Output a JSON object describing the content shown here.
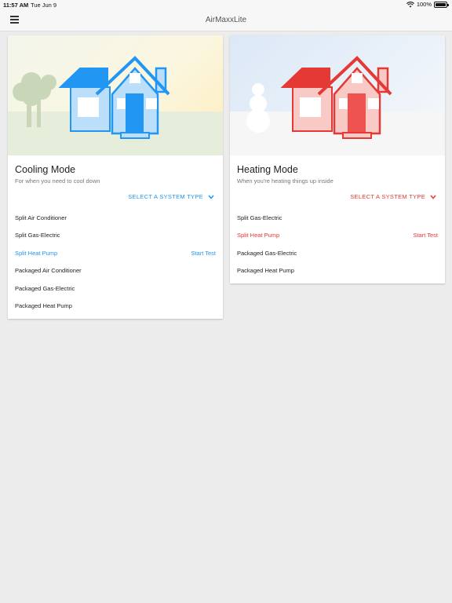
{
  "status_bar": {
    "time": "11:57 AM",
    "date": "Tue Jun 9",
    "battery": "100%"
  },
  "app_bar": {
    "title": "AirMaxxLite",
    "menu_icon": "hamburger-menu-icon"
  },
  "cooling_card": {
    "title": "Cooling Mode",
    "subtitle": "For when you need to cool down",
    "select_label": "SELECT A SYSTEM TYPE",
    "accent": "#2196f3",
    "items": [
      {
        "label": "Split Air Conditioner"
      },
      {
        "label": "Split Gas-Electric"
      },
      {
        "label": "Split Heat Pump",
        "action": "Start Test"
      },
      {
        "label": "Packaged Air Conditioner"
      },
      {
        "label": "Packaged Gas-Electric"
      },
      {
        "label": "Packaged Heat Pump"
      }
    ]
  },
  "heating_card": {
    "title": "Heating Mode",
    "subtitle": "When you're heating things up inside",
    "select_label": "SELECT A SYSTEM TYPE",
    "accent": "#e53935",
    "items": [
      {
        "label": "Split Gas-Electric"
      },
      {
        "label": "Split Heat Pump",
        "action": "Start Test"
      },
      {
        "label": "Packaged Gas-Electric"
      },
      {
        "label": "Packaged Heat Pump"
      }
    ]
  }
}
